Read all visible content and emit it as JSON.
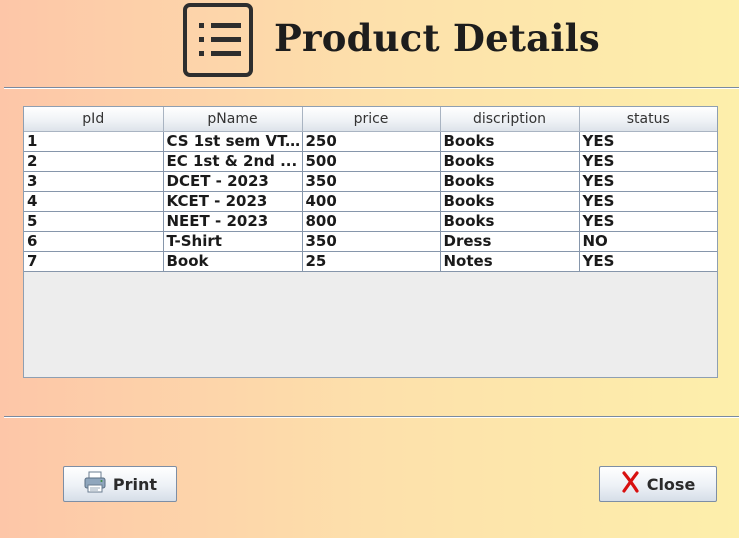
{
  "header": {
    "title": "Product Details",
    "icon": "list-icon"
  },
  "table": {
    "columns": [
      "pId",
      "pName",
      "price",
      "discription",
      "status"
    ],
    "rows": [
      [
        "1",
        "CS 1st sem VT...",
        "250",
        "Books",
        "YES"
      ],
      [
        "2",
        "EC 1st & 2nd ...",
        "500",
        "Books",
        "YES"
      ],
      [
        "3",
        "DCET - 2023",
        "350",
        "Books",
        "YES"
      ],
      [
        "4",
        "KCET - 2023",
        "400",
        "Books",
        "YES"
      ],
      [
        "5",
        "NEET - 2023",
        "800",
        "Books",
        "YES"
      ],
      [
        "6",
        "T-Shirt",
        "350",
        "Dress",
        "NO"
      ],
      [
        "7",
        "Book",
        "25",
        "Notes",
        "YES"
      ]
    ]
  },
  "buttons": {
    "print_label": "Print",
    "print_icon": "printer-icon",
    "close_label": "Close",
    "close_icon": "close-icon",
    "close_icon_color": "#d81010"
  }
}
